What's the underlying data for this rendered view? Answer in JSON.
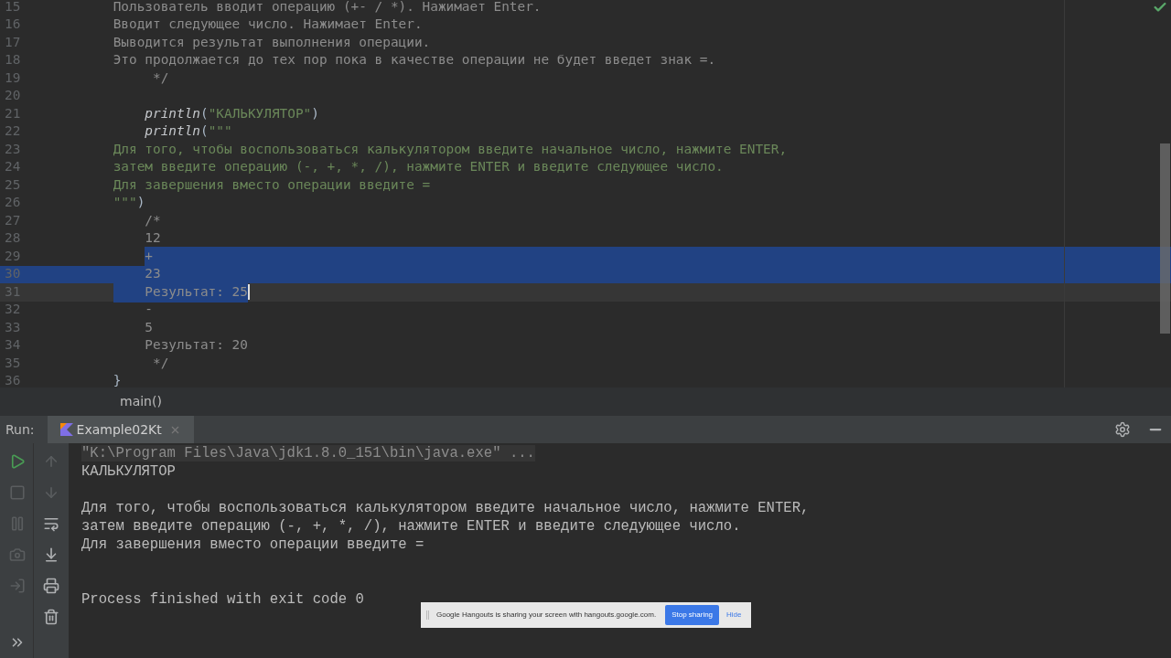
{
  "editor": {
    "lines": [
      {
        "number": "15",
        "segments": [
          {
            "text": "    Пользователь вводит операцию (+- / *). Нажимает Enter.",
            "kind": "comment"
          }
        ],
        "selected": false,
        "current": false
      },
      {
        "number": "16",
        "segments": [
          {
            "text": "    Вводит следующее число. Нажимает Enter.",
            "kind": "comment"
          }
        ],
        "selected": false,
        "current": false
      },
      {
        "number": "17",
        "segments": [
          {
            "text": "    Выводится результат выполнения операции.",
            "kind": "comment"
          }
        ],
        "selected": false,
        "current": false
      },
      {
        "number": "18",
        "segments": [
          {
            "text": "    Это продолжается до тех пор пока в качестве операции не будет введет знак =.",
            "kind": "comment"
          }
        ],
        "selected": false,
        "current": false
      },
      {
        "number": "19",
        "segments": [
          {
            "text": "         */",
            "kind": "comment"
          }
        ],
        "selected": false,
        "current": false
      },
      {
        "number": "20",
        "selected": false,
        "current": false
      },
      {
        "number": "21",
        "segments": [
          {
            "text": "        println",
            "kind": "function"
          },
          {
            "text": "(",
            "kind": "plain"
          },
          {
            "text": "\"КАЛЬКУЛЯТОР\"",
            "kind": "string"
          },
          {
            "text": ")",
            "kind": "plain"
          }
        ],
        "selected": false,
        "current": false
      },
      {
        "number": "22",
        "segments": [
          {
            "text": "        println",
            "kind": "function"
          },
          {
            "text": "(",
            "kind": "plain"
          },
          {
            "text": "\"\"\"",
            "kind": "string"
          }
        ],
        "selected": false,
        "current": false
      },
      {
        "number": "23",
        "segments": [
          {
            "text": "    Для того, чтобы воспользоваться калькулятором введите начальное число, нажмите ENTER,",
            "kind": "string"
          }
        ],
        "selected": false,
        "current": false
      },
      {
        "number": "24",
        "segments": [
          {
            "text": "    затем введите операцию (-, +, *, /), нажмите ENTER и введите следующее число.",
            "kind": "string"
          }
        ],
        "selected": false,
        "current": false
      },
      {
        "number": "25",
        "segments": [
          {
            "text": "    Для завершения вместо операции введите =",
            "kind": "string"
          }
        ],
        "selected": false,
        "current": false
      },
      {
        "number": "26",
        "segments": [
          {
            "text": "    \"\"\"",
            "kind": "string"
          },
          {
            "text": ")",
            "kind": "plain"
          }
        ],
        "selected": false,
        "current": false
      },
      {
        "number": "27",
        "segments": [
          {
            "text": "        /*",
            "kind": "comment"
          }
        ],
        "selected": false,
        "current": false
      },
      {
        "number": "28",
        "segments": [
          {
            "text": "        12",
            "kind": "comment"
          }
        ],
        "selected": false,
        "current": false
      },
      {
        "number": "29",
        "segments": [
          {
            "text": "        +",
            "kind": "comment"
          }
        ],
        "selected": true,
        "current": false
      },
      {
        "number": "30",
        "segments": [
          {
            "text": "        23",
            "kind": "comment"
          }
        ],
        "selected": true,
        "current": false
      },
      {
        "number": "31",
        "segments": [
          {
            "text": "        Результат: 25",
            "kind": "comment"
          }
        ],
        "selected": true,
        "current": true
      },
      {
        "number": "32",
        "segments": [
          {
            "text": "        -",
            "kind": "comment"
          }
        ],
        "selected": false,
        "current": false
      },
      {
        "number": "33",
        "segments": [
          {
            "text": "        5",
            "kind": "comment"
          }
        ],
        "selected": false,
        "current": false
      },
      {
        "number": "34",
        "segments": [
          {
            "text": "        Результат: 20",
            "kind": "comment"
          }
        ],
        "selected": false,
        "current": false
      },
      {
        "number": "35",
        "segments": [
          {
            "text": "         */",
            "kind": "comment"
          }
        ],
        "selected": false,
        "current": false
      },
      {
        "number": "36",
        "segments": [
          {
            "text": "    }",
            "kind": "plain"
          }
        ],
        "selected": false,
        "current": false
      }
    ]
  },
  "breadcrumb": "main()",
  "run_panel": {
    "label": "Run:",
    "tabs": [
      {
        "title": "Example02Kt",
        "selected": true
      }
    ],
    "console": [
      {
        "kind": "command",
        "text": "\"K:\\Program Files\\Java\\jdk1.8.0_151\\bin\\java.exe\" ..."
      },
      {
        "kind": "output",
        "text": "КАЛЬКУЛЯТОР"
      },
      {
        "kind": "blank"
      },
      {
        "kind": "output",
        "text": "Для того, чтобы воспользоваться калькулятором введите начальное число, нажмите ENTER,"
      },
      {
        "kind": "output",
        "text": "затем введите операцию (-, +, *, /), нажмите ENTER и введите следующее число."
      },
      {
        "kind": "output",
        "text": "Для завершения вместо операции введите ="
      },
      {
        "kind": "blank"
      },
      {
        "kind": "blank"
      },
      {
        "kind": "output",
        "text": "Process finished with exit code 0"
      }
    ]
  },
  "share_bar": {
    "message": "Google Hangouts is sharing your screen with hangouts.google.com.",
    "stop_button": "Stop sharing",
    "hide_link": "Hide"
  }
}
